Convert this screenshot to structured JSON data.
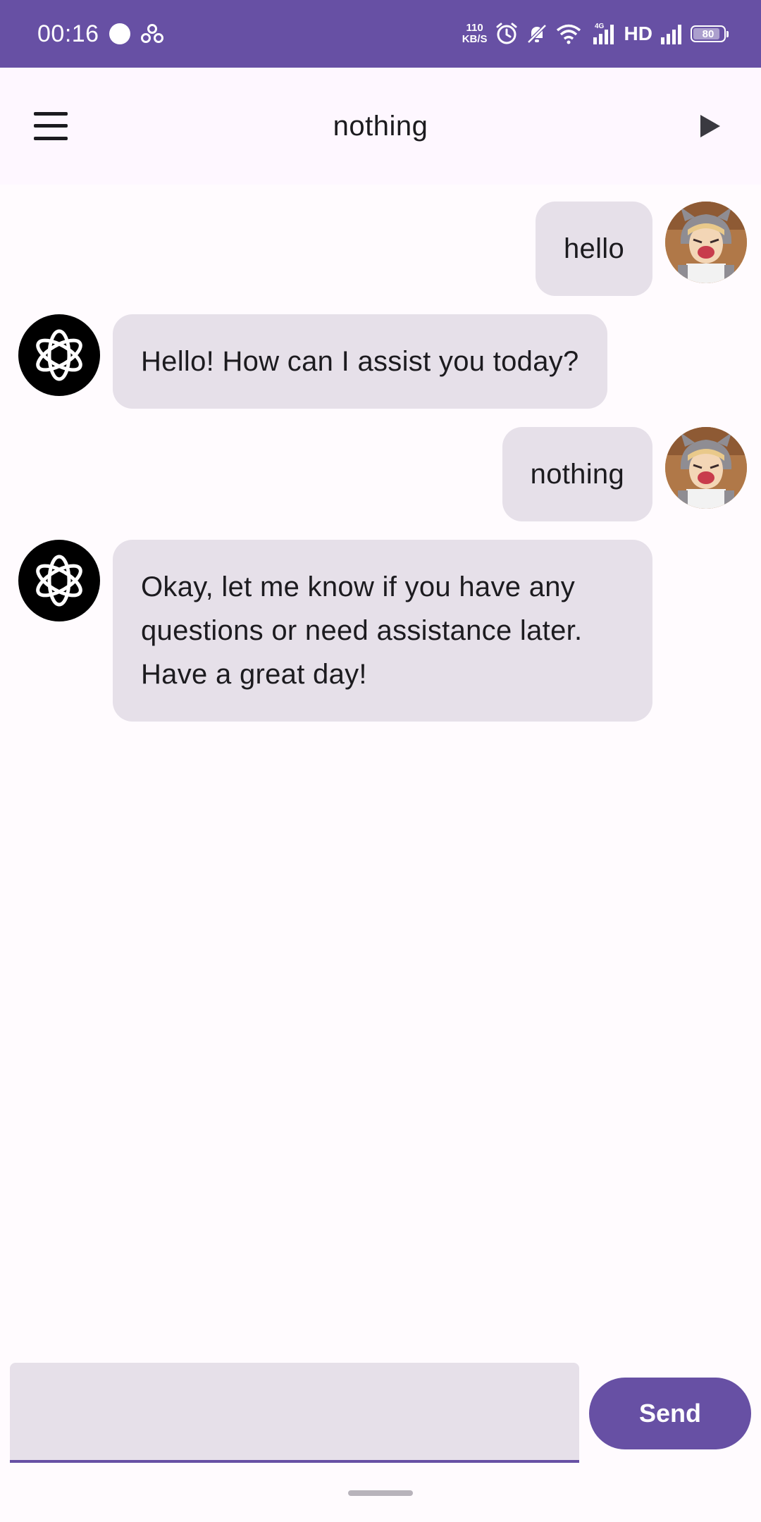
{
  "status_bar": {
    "time": "00:16",
    "speed_value": "110",
    "speed_unit": "KB/S",
    "network_label": "4G",
    "hd_label": "HD",
    "battery": "80",
    "battery_level": 0.8
  },
  "app_bar": {
    "title": "nothing"
  },
  "messages": [
    {
      "role": "user",
      "text": "hello"
    },
    {
      "role": "assistant",
      "text": "Hello! How can I assist you today?"
    },
    {
      "role": "user",
      "text": "nothing"
    },
    {
      "role": "assistant",
      "text_lines": [
        "Okay, let me know if you have any",
        "questions or need assistance later.",
        "Have a great day!"
      ]
    }
  ],
  "composer": {
    "value": "",
    "send_label": "Send"
  },
  "colors": {
    "primary": "#6750a4",
    "bubble": "#e6e0e9",
    "background": "#fffbfe"
  }
}
